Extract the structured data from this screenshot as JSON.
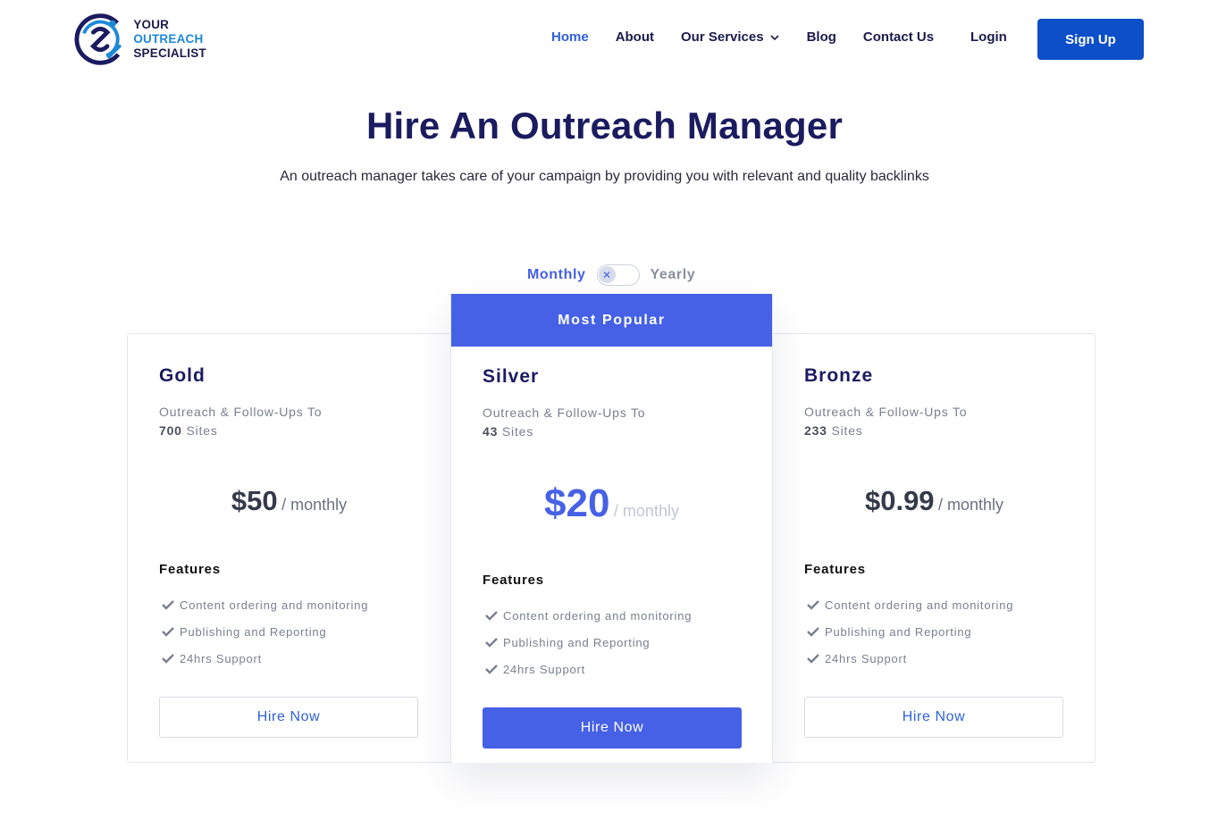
{
  "brand": {
    "line1": "YOUR",
    "line1_accent": "OUTREACH",
    "line2": "SPECIALIST",
    "color_primary": "#1b1b60",
    "color_accent": "#1e88d6"
  },
  "nav": {
    "items": [
      {
        "label": "Home",
        "active": true
      },
      {
        "label": "About"
      },
      {
        "label": "Our Services",
        "has_dropdown": true
      },
      {
        "label": "Blog"
      },
      {
        "label": "Contact Us"
      }
    ],
    "login": "Login",
    "signup": "Sign Up"
  },
  "hero": {
    "title": "Hire An Outreach Manager",
    "subtitle": "An outreach manager takes care of your campaign by providing you with relevant and quality backlinks"
  },
  "billing": {
    "monthly": "Monthly",
    "yearly": "Yearly",
    "selected": "Monthly"
  },
  "plans": [
    {
      "name": "Gold",
      "desc": "Outreach & Follow-Ups To",
      "sites_count": "700",
      "sites_label": "Sites",
      "price": "$50",
      "period": "/ monthly",
      "features_title": "Features",
      "features": [
        "Content ordering and monitoring",
        "Publishing and Reporting",
        "24hrs Support"
      ],
      "cta": "Hire Now"
    },
    {
      "badge": "Most Popular",
      "name": "Silver",
      "desc": "Outreach & Follow-Ups To",
      "sites_count": "43",
      "sites_label": "Sites",
      "price": "$20",
      "period": "/ monthly",
      "features_title": "Features",
      "features": [
        "Content ordering and monitoring",
        "Publishing and Reporting",
        "24hrs Support"
      ],
      "cta": "Hire Now"
    },
    {
      "name": "Bronze",
      "desc": "Outreach & Follow-Ups To",
      "sites_count": "233",
      "sites_label": "Sites",
      "price": "$0.99",
      "period": "/ monthly",
      "features_title": "Features",
      "features": [
        "Content ordering and monitoring",
        "Publishing and Reporting",
        "24hrs Support"
      ],
      "cta": "Hire Now"
    }
  ],
  "colors": {
    "brand_blue": "#0d4fc9",
    "accent": "#4660e6",
    "heading": "#1b1b60"
  }
}
